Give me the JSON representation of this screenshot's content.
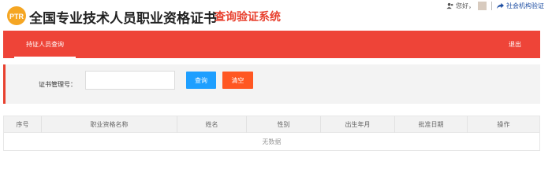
{
  "header": {
    "title_main": "全国专业技术人员职业资格证书",
    "title_sub": "查询验证系统",
    "logo_text": "PTR",
    "greeting": "您好，",
    "org_link": "社会机构验证"
  },
  "nav": {
    "active_tab": "持证人员查询",
    "logout": "退出"
  },
  "search": {
    "label": "证书管理号：",
    "input_value": "",
    "input_placeholder": "",
    "query_button": "查询",
    "clear_button": "清空"
  },
  "table": {
    "columns": [
      "序号",
      "职业资格名称",
      "姓名",
      "性别",
      "出生年月",
      "批准日期",
      "操作"
    ],
    "empty_text": "无数据"
  },
  "colors": {
    "brand_red": "#ee4438",
    "query_blue": "#1e9fff",
    "clear_orange": "#ff5722",
    "link_blue": "#1f4fa3"
  },
  "icons": {
    "user": "user-icon",
    "share": "share-icon",
    "logo": "ptr-logo"
  }
}
